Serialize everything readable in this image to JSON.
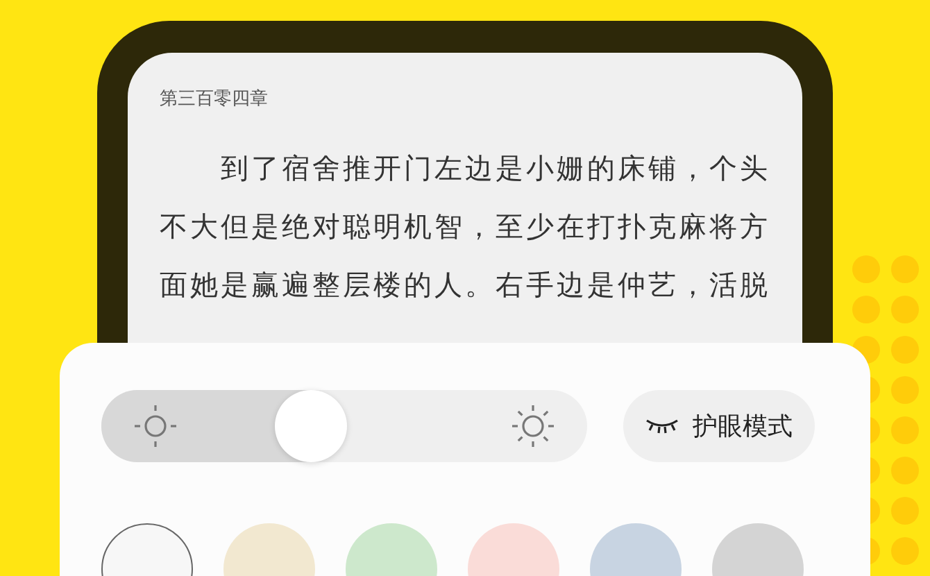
{
  "reader": {
    "chapter_title": "第三百零四章",
    "paragraph": "到了宿舍推开门左边是小姗的床铺，个头不大但是绝对聪明机智，至少在打扑克麻将方面她是赢遍整层楼的人。右手边是仲艺，活脱"
  },
  "settings_panel": {
    "brightness": {
      "level": 0.43
    },
    "eye_care_button": {
      "label": "护眼模式"
    },
    "themes": [
      {
        "color": "#f7f7f7",
        "selected": true
      },
      {
        "color": "#f2e8d0",
        "selected": false
      },
      {
        "color": "#cde8cc",
        "selected": false
      },
      {
        "color": "#fadcd8",
        "selected": false
      },
      {
        "color": "#c8d4e2",
        "selected": false
      },
      {
        "color": "#d4d4d4",
        "selected": false
      }
    ]
  }
}
